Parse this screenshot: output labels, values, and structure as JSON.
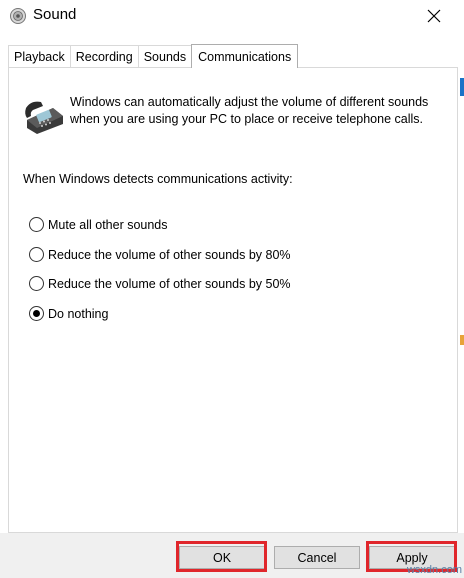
{
  "window": {
    "title": "Sound",
    "close_label": "✕"
  },
  "tabs": [
    {
      "label": "Playback"
    },
    {
      "label": "Recording"
    },
    {
      "label": "Sounds"
    },
    {
      "label": "Communications",
      "active": true
    }
  ],
  "communications": {
    "intro": "Windows can automatically adjust the volume of different sounds when you are using your PC to place or receive telephone calls.",
    "detect_label": "When Windows detects communications activity:",
    "options": [
      {
        "label": "Mute all other sounds",
        "checked": false
      },
      {
        "label": "Reduce the volume of other sounds by 80%",
        "checked": false
      },
      {
        "label": "Reduce the volume of other sounds by 50%",
        "checked": false
      },
      {
        "label": "Do nothing",
        "checked": true
      }
    ]
  },
  "footer": {
    "ok_label": "OK",
    "cancel_label": "Cancel",
    "apply_label": "Apply"
  },
  "watermark": "wsxdn.com",
  "icons": {
    "app": "speaker-icon",
    "close": "close-icon",
    "phone": "telephone-icon"
  },
  "colors": {
    "highlight": "#e0262b",
    "footer_bg": "#f0f0f0",
    "button_bg": "#e1e1e1"
  }
}
